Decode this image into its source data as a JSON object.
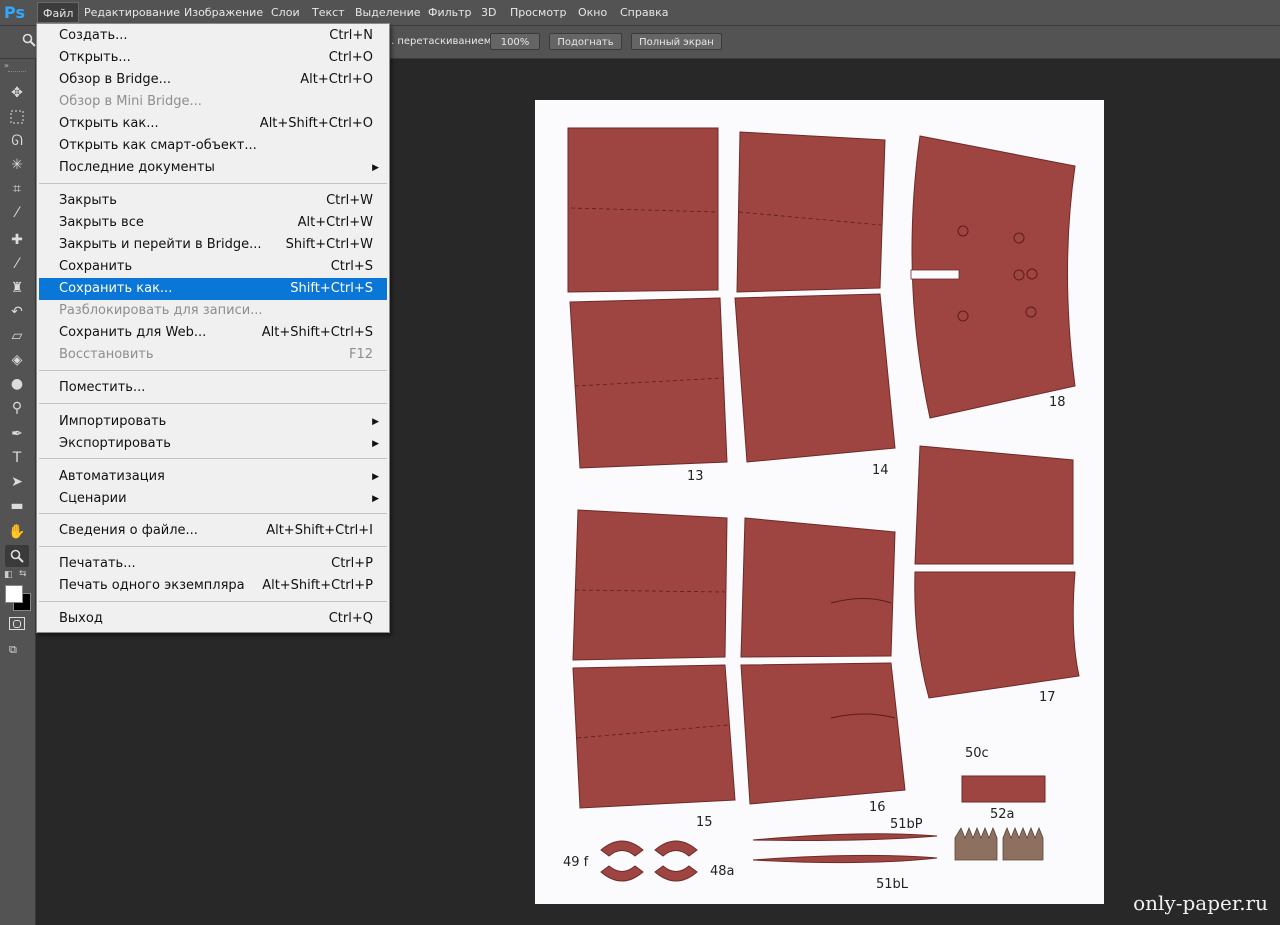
{
  "app": {
    "logo": "Ps"
  },
  "menubar": [
    "Файл",
    "Редактирование",
    "Изображение",
    "Слои",
    "Текст",
    "Выделение",
    "Фильтр",
    "3D",
    "Просмотр",
    "Окно",
    "Справка"
  ],
  "options": {
    "drag_label": ". перетаскиванием",
    "btn_100": "100%",
    "btn_fit": "Подогнать",
    "btn_full": "Полный экран"
  },
  "file_menu": [
    {
      "label": "Создать...",
      "shortcut": "Ctrl+N"
    },
    {
      "label": "Открыть...",
      "shortcut": "Ctrl+O"
    },
    {
      "label": "Обзор в Bridge...",
      "shortcut": "Alt+Ctrl+O"
    },
    {
      "label": "Обзор в Mini Bridge...",
      "shortcut": "",
      "disabled": true
    },
    {
      "label": "Открыть как...",
      "shortcut": "Alt+Shift+Ctrl+O"
    },
    {
      "label": "Открыть как смарт-объект...",
      "shortcut": ""
    },
    {
      "label": "Последние документы",
      "shortcut": "",
      "submenu": true
    },
    {
      "label": "Закрыть",
      "shortcut": "Ctrl+W"
    },
    {
      "label": "Закрыть все",
      "shortcut": "Alt+Ctrl+W"
    },
    {
      "label": "Закрыть и перейти в Bridge...",
      "shortcut": "Shift+Ctrl+W"
    },
    {
      "label": "Сохранить",
      "shortcut": "Ctrl+S"
    },
    {
      "label": "Сохранить как...",
      "shortcut": "Shift+Ctrl+S",
      "highlighted": true
    },
    {
      "label": "Разблокировать для записи...",
      "shortcut": "",
      "disabled": true
    },
    {
      "label": "Сохранить для Web...",
      "shortcut": "Alt+Shift+Ctrl+S"
    },
    {
      "label": "Восстановить",
      "shortcut": "F12",
      "disabled": true
    },
    {
      "label": "Поместить...",
      "shortcut": ""
    },
    {
      "label": "Импортировать",
      "shortcut": "",
      "submenu": true
    },
    {
      "label": "Экспортировать",
      "shortcut": "",
      "submenu": true
    },
    {
      "label": "Автоматизация",
      "shortcut": "",
      "submenu": true
    },
    {
      "label": "Сценарии",
      "shortcut": "",
      "submenu": true
    },
    {
      "label": "Сведения о файле...",
      "shortcut": "Alt+Shift+Ctrl+I"
    },
    {
      "label": "Печатать...",
      "shortcut": "Ctrl+P"
    },
    {
      "label": "Печать одного экземпляра",
      "shortcut": "Alt+Shift+Ctrl+P"
    },
    {
      "label": "Выход",
      "shortcut": "Ctrl+Q"
    }
  ],
  "tools": [
    "move-tool-icon",
    "marquee-tool-icon",
    "lasso-tool-icon",
    "magic-wand-icon",
    "crop-tool-icon",
    "eyedropper-icon",
    "healing-brush-icon",
    "brush-icon",
    "clone-stamp-icon",
    "history-brush-icon",
    "eraser-icon",
    "paint-bucket-icon",
    "blur-tool-icon",
    "dodge-tool-icon",
    "pen-tool-icon",
    "type-tool-icon",
    "path-selection-icon",
    "shape-tool-icon",
    "hand-tool-icon",
    "zoom-tool-icon"
  ],
  "canvas_labels": {
    "p13": "13",
    "p14": "14",
    "p18": "18",
    "p15": "15",
    "p16": "16",
    "p17": "17",
    "p50c": "50c",
    "p52a": "52a",
    "p51bP": "51bP",
    "p51bL": "51bL",
    "p49f": "49 f",
    "p48a": "48a"
  },
  "colors": {
    "paper_red": "#9e4541",
    "menu_highlight": "#0a76d8",
    "ui_bg": "#535353",
    "workspace": "#282828"
  },
  "watermark": "only-paper.ru"
}
